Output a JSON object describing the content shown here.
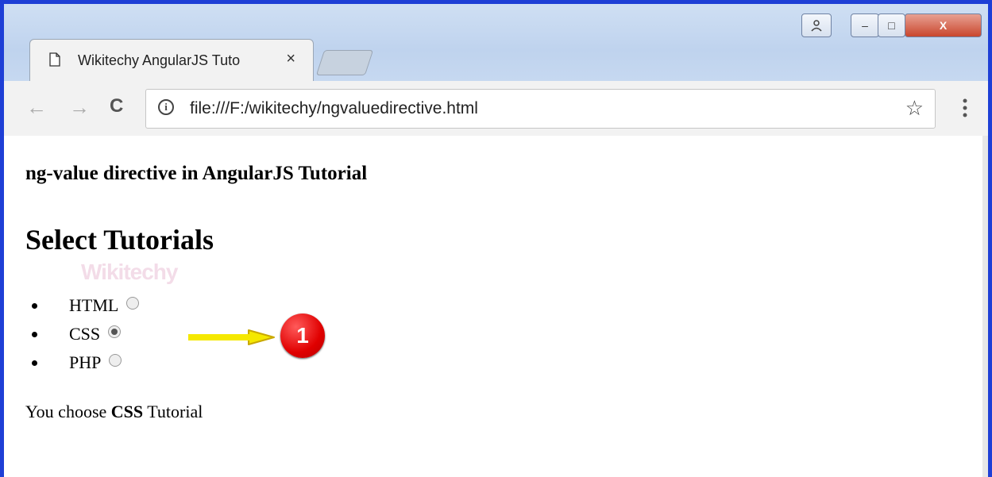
{
  "browser": {
    "tab_title": "Wikitechy AngularJS Tuto",
    "tab_close": "×",
    "url": "file:///F:/wikitechy/ngvaluedirective.html",
    "info": "i",
    "back": "←",
    "forward": "→",
    "reload": "C",
    "bookmark": "☆",
    "menu": "⋮",
    "window_buttons": {
      "profile": "👤",
      "minimize": "–",
      "maximize": "□",
      "close": "X"
    }
  },
  "page": {
    "heading": "ng-value directive in AngularJS Tutorial",
    "subheading": "Select Tutorials",
    "watermark": "Wikitechy",
    "options": [
      {
        "label": "HTML",
        "checked": false
      },
      {
        "label": "CSS",
        "checked": true
      },
      {
        "label": "PHP",
        "checked": false
      }
    ],
    "result_prefix": "You choose ",
    "result_value": "CSS",
    "result_suffix": " Tutorial"
  },
  "annotation": {
    "badge_number": "1",
    "arrow_color": "#f5e800",
    "badge_color": "#e00000"
  }
}
